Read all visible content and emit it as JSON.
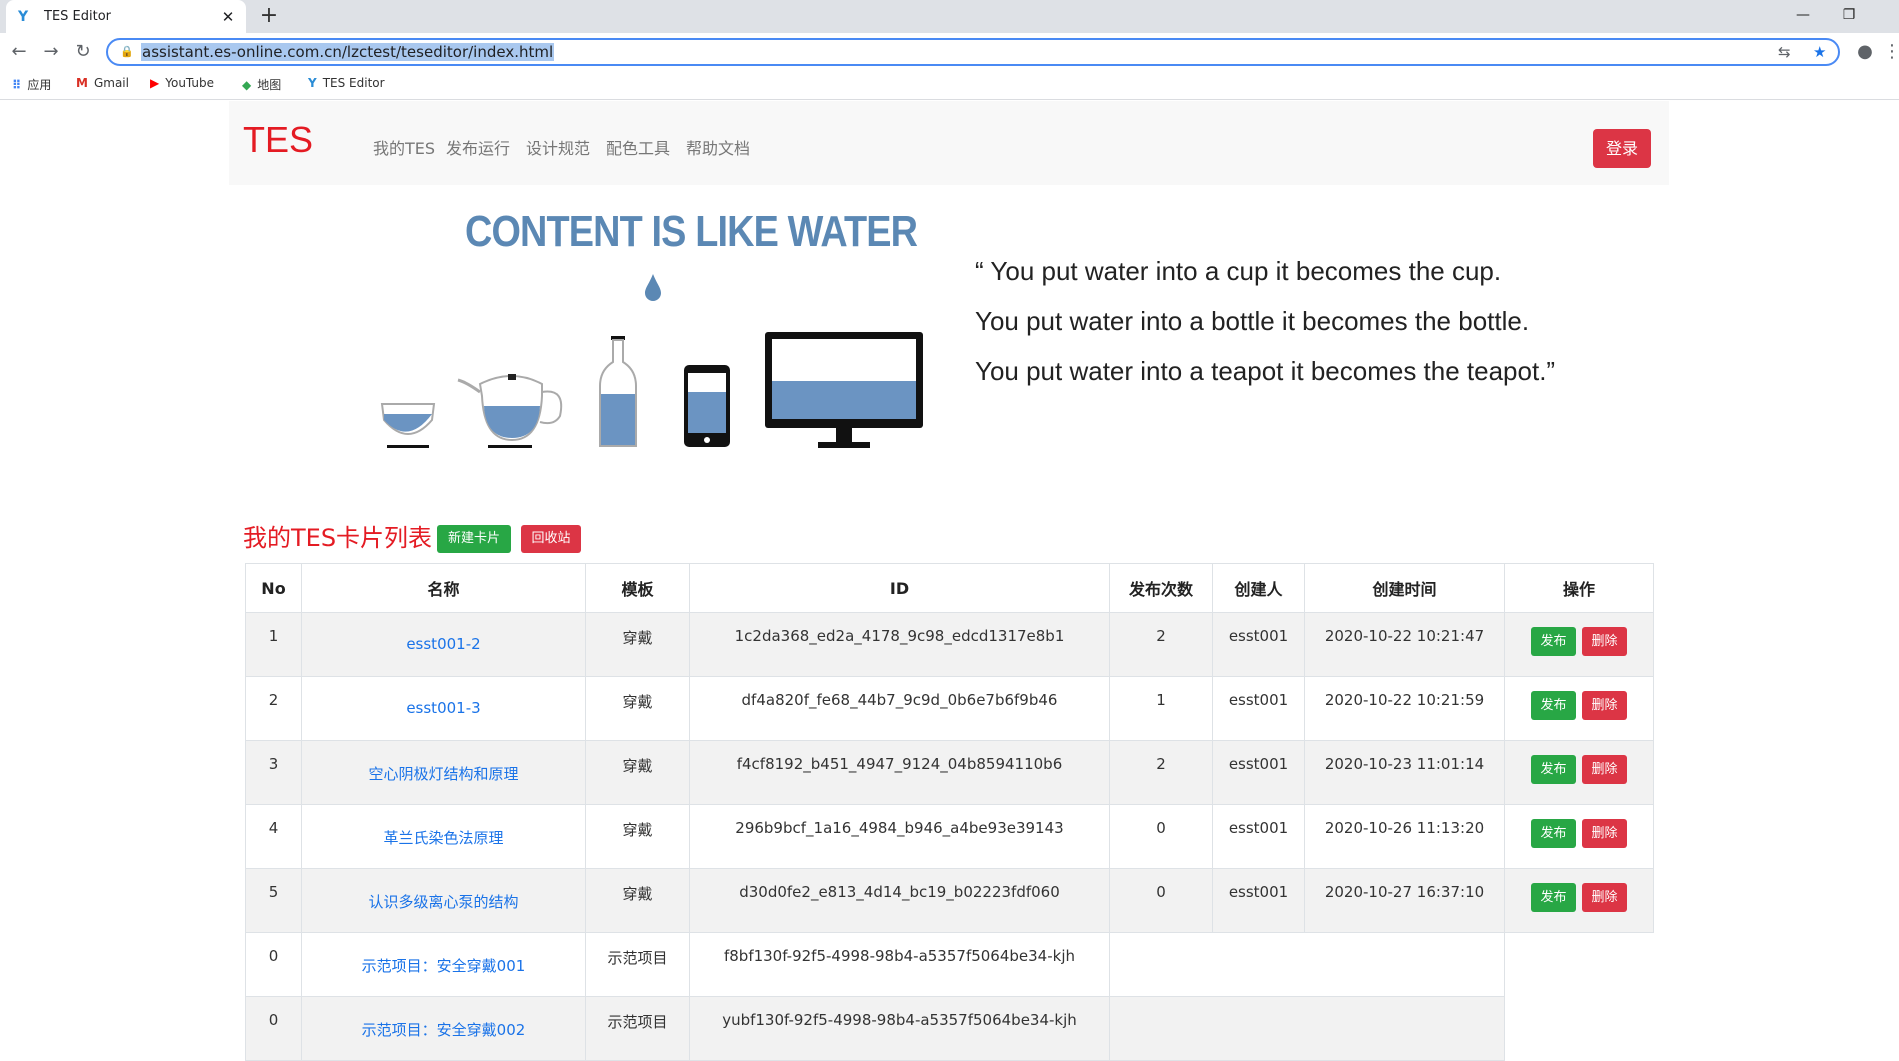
{
  "browser": {
    "tab_title": "TES Editor",
    "tab_close": "✕",
    "new_tab": "+",
    "url": "assistant.es-online.com.cn/lzctest/teseditor/index.html",
    "bookmarks": [
      {
        "icon": "apps-grid-icon",
        "label": "应用"
      },
      {
        "icon": "gmail-icon",
        "label": "Gmail"
      },
      {
        "icon": "youtube-icon",
        "label": "YouTube"
      },
      {
        "icon": "maps-icon",
        "label": "地图"
      },
      {
        "icon": "tes-favicon-icon",
        "label": "TES Editor"
      }
    ]
  },
  "navbar": {
    "brand": "TES",
    "links": [
      "我的TES",
      "发布运行",
      "设计规范",
      "配色工具",
      "帮助文档"
    ],
    "login": "登录"
  },
  "hero": {
    "title": "CONTENT IS LIKE WATER",
    "quote": [
      "“ You put water into a cup it becomes the cup.",
      "You put water into a bottle it becomes the bottle.",
      "You put water into a teapot it becomes the teapot.”"
    ]
  },
  "list": {
    "title": "我的TES卡片列表",
    "new_button": "新建卡片",
    "recycle_button": "回收站"
  },
  "table": {
    "headers": [
      "No",
      "名称",
      "模板",
      "ID",
      "发布次数",
      "创建人",
      "创建时间",
      "操作"
    ],
    "publish_label": "发布",
    "delete_label": "删除",
    "rows": [
      {
        "no": "1",
        "name": "esst001-2",
        "template": "穿戴",
        "id": "1c2da368_ed2a_4178_9c98_edcd1317e8b1",
        "count": "2",
        "creator": "esst001",
        "created": "2020-10-22 10:21:47"
      },
      {
        "no": "2",
        "name": "esst001-3",
        "template": "穿戴",
        "id": "df4a820f_fe68_44b7_9c9d_0b6e7b6f9b46",
        "count": "1",
        "creator": "esst001",
        "created": "2020-10-22 10:21:59"
      },
      {
        "no": "3",
        "name": "空心阴极灯结构和原理",
        "template": "穿戴",
        "id": "f4cf8192_b451_4947_9124_04b8594110b6",
        "count": "2",
        "creator": "esst001",
        "created": "2020-10-23 11:01:14"
      },
      {
        "no": "4",
        "name": "革兰氏染色法原理",
        "template": "穿戴",
        "id": "296b9bcf_1a16_4984_b946_a4be93e39143",
        "count": "0",
        "creator": "esst001",
        "created": "2020-10-26 11:13:20"
      },
      {
        "no": "5",
        "name": "认识多级离心泵的结构",
        "template": "穿戴",
        "id": "d30d0fe2_e813_4d14_bc19_b02223fdf060",
        "count": "0",
        "creator": "esst001",
        "created": "2020-10-27 16:37:10"
      }
    ],
    "sample_rows": [
      {
        "no": "0",
        "name": "示范项目：安全穿戴001",
        "template": "示范项目",
        "id": "f8bf130f-92f5-4998-98b4-a5357f5064be34-kjh"
      },
      {
        "no": "0",
        "name": "示范项目：安全穿戴002",
        "template": "示范项目",
        "id": "yubf130f-92f5-4998-98b4-a5357f5064be34-kjh"
      }
    ]
  },
  "colors": {
    "brand_red": "#e41b23",
    "success_green": "#28a745",
    "danger_red": "#dc3545",
    "water_blue": "#6b94c2"
  }
}
